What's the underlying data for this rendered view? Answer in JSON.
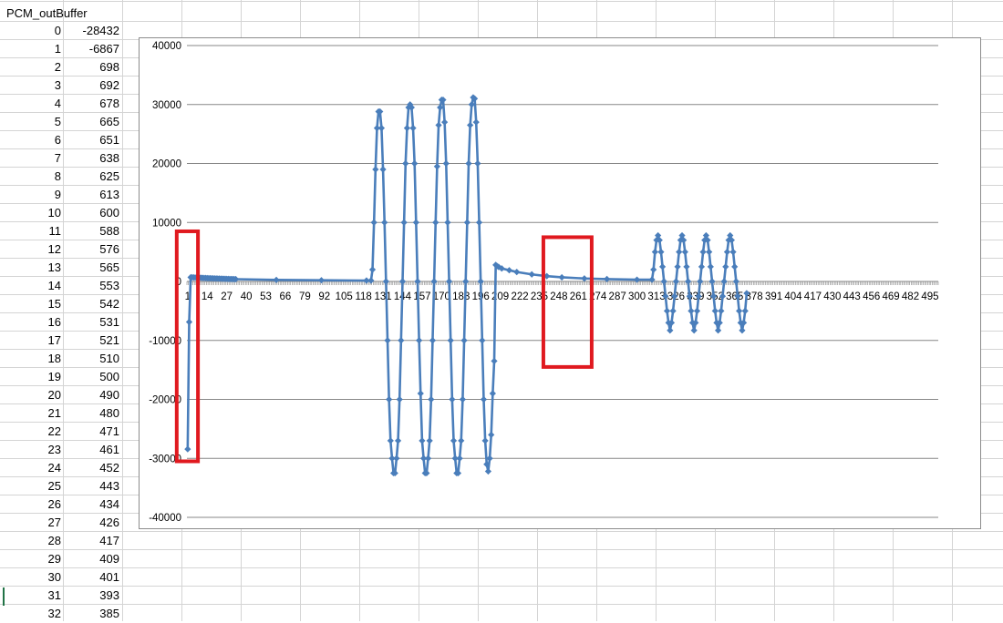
{
  "sheet": {
    "header": "PCM_outBuffer",
    "rows": [
      {
        "index": "0",
        "value": "-28432"
      },
      {
        "index": "1",
        "value": "-6867"
      },
      {
        "index": "2",
        "value": "698"
      },
      {
        "index": "3",
        "value": "692"
      },
      {
        "index": "4",
        "value": "678"
      },
      {
        "index": "5",
        "value": "665"
      },
      {
        "index": "6",
        "value": "651"
      },
      {
        "index": "7",
        "value": "638"
      },
      {
        "index": "8",
        "value": "625"
      },
      {
        "index": "9",
        "value": "613"
      },
      {
        "index": "10",
        "value": "600"
      },
      {
        "index": "11",
        "value": "588"
      },
      {
        "index": "12",
        "value": "576"
      },
      {
        "index": "13",
        "value": "565"
      },
      {
        "index": "14",
        "value": "553"
      },
      {
        "index": "15",
        "value": "542"
      },
      {
        "index": "16",
        "value": "531"
      },
      {
        "index": "17",
        "value": "521"
      },
      {
        "index": "18",
        "value": "510"
      },
      {
        "index": "19",
        "value": "500"
      },
      {
        "index": "20",
        "value": "490"
      },
      {
        "index": "21",
        "value": "480"
      },
      {
        "index": "22",
        "value": "471"
      },
      {
        "index": "23",
        "value": "461"
      },
      {
        "index": "24",
        "value": "452"
      },
      {
        "index": "25",
        "value": "443"
      },
      {
        "index": "26",
        "value": "434"
      },
      {
        "index": "27",
        "value": "426"
      },
      {
        "index": "28",
        "value": "417"
      },
      {
        "index": "29",
        "value": "409"
      },
      {
        "index": "30",
        "value": "401"
      },
      {
        "index": "31",
        "value": "393"
      },
      {
        "index": "32",
        "value": "385"
      }
    ]
  },
  "colors": {
    "series": "#4a7ebb",
    "highlight": "#e0191f",
    "gridline": "#878787",
    "sheet_grid": "#d4d4d4"
  },
  "chart_data": {
    "type": "line",
    "title": "",
    "xlabel": "",
    "ylabel": "",
    "ylim": [
      -40000,
      40000
    ],
    "ytick_values": [
      40000,
      30000,
      20000,
      10000,
      0,
      -10000,
      -20000,
      -30000,
      -40000
    ],
    "yticks": [
      "40000",
      "30000",
      "20000",
      "10000",
      "0",
      "-10000",
      "-20000",
      "-30000",
      "-40000"
    ],
    "xticks": [
      "1",
      "14",
      "27",
      "40",
      "53",
      "66",
      "79",
      "92",
      "105",
      "118",
      "131",
      "144",
      "157",
      "170",
      "183",
      "196",
      "209",
      "222",
      "235",
      "248",
      "261",
      "274",
      "287",
      "300",
      "313",
      "326",
      "339",
      "352",
      "365",
      "378",
      "391",
      "404",
      "417",
      "430",
      "443",
      "456",
      "469",
      "482",
      "495"
    ],
    "n_points": 500,
    "marker": "diamond",
    "grid": true,
    "legend": "none",
    "highlight_boxes": [
      {
        "x_from": 1,
        "x_to": 3,
        "y_top": 8500,
        "y_bottom": -30500
      },
      {
        "x_from": 245,
        "x_to": 265,
        "y_top": 7500,
        "y_bottom": -14500
      }
    ],
    "series": [
      {
        "points": [
          [
            1,
            -28432
          ],
          [
            2,
            -6867
          ],
          [
            3,
            698
          ],
          [
            4,
            692
          ],
          [
            5,
            678
          ],
          [
            6,
            665
          ],
          [
            7,
            651
          ],
          [
            8,
            638
          ],
          [
            9,
            625
          ],
          [
            10,
            613
          ],
          [
            11,
            600
          ],
          [
            12,
            588
          ],
          [
            13,
            576
          ],
          [
            14,
            565
          ],
          [
            15,
            553
          ],
          [
            16,
            542
          ],
          [
            17,
            531
          ],
          [
            18,
            521
          ],
          [
            19,
            510
          ],
          [
            20,
            500
          ],
          [
            21,
            490
          ],
          [
            22,
            480
          ],
          [
            23,
            471
          ],
          [
            24,
            461
          ],
          [
            25,
            452
          ],
          [
            26,
            443
          ],
          [
            27,
            434
          ],
          [
            28,
            426
          ],
          [
            29,
            417
          ],
          [
            30,
            409
          ],
          [
            31,
            401
          ],
          [
            32,
            393
          ],
          [
            33,
            385
          ],
          [
            60,
            260
          ],
          [
            90,
            200
          ],
          [
            120,
            150
          ],
          [
            123,
            150
          ],
          [
            124,
            2000
          ],
          [
            125,
            10000
          ],
          [
            126,
            19000
          ],
          [
            127,
            26000
          ],
          [
            128,
            28800
          ],
          [
            129,
            28800
          ],
          [
            130,
            26000
          ],
          [
            131,
            19000
          ],
          [
            132,
            10000
          ],
          [
            133,
            0
          ],
          [
            134,
            -10000
          ],
          [
            135,
            -20000
          ],
          [
            136,
            -27000
          ],
          [
            137,
            -30000
          ],
          [
            138,
            -32500
          ],
          [
            139,
            -32500
          ],
          [
            140,
            -30000
          ],
          [
            141,
            -27000
          ],
          [
            142,
            -20000
          ],
          [
            143,
            -10000
          ],
          [
            144,
            0
          ],
          [
            145,
            10000
          ],
          [
            146,
            20000
          ],
          [
            147,
            26000
          ],
          [
            148,
            29500
          ],
          [
            149,
            30000
          ],
          [
            150,
            29500
          ],
          [
            151,
            26000
          ],
          [
            152,
            20000
          ],
          [
            153,
            10000
          ],
          [
            154,
            0
          ],
          [
            155,
            -10000
          ],
          [
            156,
            -19000
          ],
          [
            157,
            -27000
          ],
          [
            158,
            -30000
          ],
          [
            159,
            -32500
          ],
          [
            160,
            -32500
          ],
          [
            161,
            -30000
          ],
          [
            162,
            -27000
          ],
          [
            163,
            -20000
          ],
          [
            164,
            -10000
          ],
          [
            165,
            0
          ],
          [
            166,
            10000
          ],
          [
            167,
            19500
          ],
          [
            168,
            26500
          ],
          [
            169,
            29500
          ],
          [
            170,
            30800
          ],
          [
            171,
            30800
          ],
          [
            172,
            27000
          ],
          [
            173,
            20000
          ],
          [
            174,
            10000
          ],
          [
            175,
            0
          ],
          [
            176,
            -10000
          ],
          [
            177,
            -20000
          ],
          [
            178,
            -27000
          ],
          [
            179,
            -30000
          ],
          [
            180,
            -32500
          ],
          [
            181,
            -32500
          ],
          [
            182,
            -30000
          ],
          [
            183,
            -27000
          ],
          [
            184,
            -20000
          ],
          [
            185,
            -10000
          ],
          [
            186,
            0
          ],
          [
            187,
            10000
          ],
          [
            188,
            20000
          ],
          [
            189,
            26500
          ],
          [
            190,
            30000
          ],
          [
            191,
            31200
          ],
          [
            192,
            31000
          ],
          [
            193,
            27000
          ],
          [
            194,
            20000
          ],
          [
            195,
            10000
          ],
          [
            196,
            0
          ],
          [
            197,
            -10000
          ],
          [
            198,
            -20000
          ],
          [
            199,
            -27000
          ],
          [
            200,
            -31000
          ],
          [
            201,
            -32200
          ],
          [
            202,
            -30000
          ],
          [
            203,
            -26000
          ],
          [
            204,
            -19000
          ],
          [
            205,
            -13500
          ],
          [
            206,
            2800
          ],
          [
            207,
            2600
          ],
          [
            208,
            2450
          ],
          [
            210,
            2200
          ],
          [
            215,
            1900
          ],
          [
            220,
            1600
          ],
          [
            230,
            1200
          ],
          [
            240,
            900
          ],
          [
            250,
            700
          ],
          [
            265,
            500
          ],
          [
            280,
            400
          ],
          [
            300,
            300
          ],
          [
            310,
            300
          ],
          [
            311,
            2000
          ],
          [
            312,
            5000
          ],
          [
            313,
            7000
          ],
          [
            314,
            7800
          ],
          [
            315,
            7000
          ],
          [
            316,
            5000
          ],
          [
            317,
            2500
          ],
          [
            318,
            0
          ],
          [
            319,
            -2500
          ],
          [
            320,
            -5000
          ],
          [
            321,
            -7000
          ],
          [
            322,
            -8300
          ],
          [
            323,
            -7000
          ],
          [
            324,
            -5000
          ],
          [
            325,
            -2500
          ],
          [
            326,
            0
          ],
          [
            327,
            2500
          ],
          [
            328,
            5000
          ],
          [
            329,
            7000
          ],
          [
            330,
            7800
          ],
          [
            331,
            7000
          ],
          [
            332,
            5000
          ],
          [
            333,
            2500
          ],
          [
            334,
            0
          ],
          [
            335,
            -2500
          ],
          [
            336,
            -5000
          ],
          [
            337,
            -7000
          ],
          [
            338,
            -8300
          ],
          [
            339,
            -7000
          ],
          [
            340,
            -5000
          ],
          [
            341,
            -2500
          ],
          [
            342,
            0
          ],
          [
            343,
            2500
          ],
          [
            344,
            5000
          ],
          [
            345,
            7000
          ],
          [
            346,
            7800
          ],
          [
            347,
            7000
          ],
          [
            348,
            5000
          ],
          [
            349,
            2500
          ],
          [
            350,
            0
          ],
          [
            351,
            -2500
          ],
          [
            352,
            -5000
          ],
          [
            353,
            -7000
          ],
          [
            354,
            -8300
          ],
          [
            355,
            -7000
          ],
          [
            356,
            -5000
          ],
          [
            357,
            -2500
          ],
          [
            358,
            0
          ],
          [
            359,
            2500
          ],
          [
            360,
            5000
          ],
          [
            361,
            7000
          ],
          [
            362,
            7800
          ],
          [
            363,
            7000
          ],
          [
            364,
            5000
          ],
          [
            365,
            2500
          ],
          [
            366,
            0
          ],
          [
            367,
            -2500
          ],
          [
            368,
            -5000
          ],
          [
            369,
            -7000
          ],
          [
            370,
            -8300
          ],
          [
            371,
            -7000
          ],
          [
            372,
            -5000
          ],
          [
            373,
            -2000
          ]
        ]
      }
    ]
  }
}
